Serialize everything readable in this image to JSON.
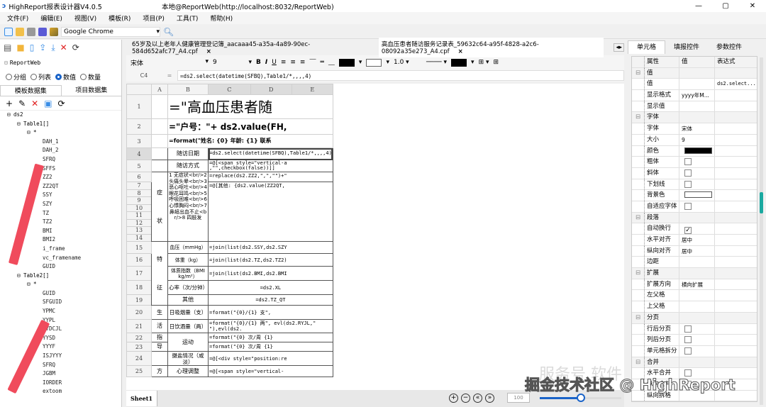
{
  "window": {
    "title": "HighReport报表设计器V4.0.5",
    "connection": "本地@ReportWeb(http://localhost:8032/ReportWeb)",
    "controls": [
      "—",
      "▢",
      "✕"
    ]
  },
  "menu": [
    "文件(F)",
    "编辑(E)",
    "视图(V)",
    "模板(R)",
    "项目(P)",
    "工具(T)",
    "帮助(H)"
  ],
  "toolbar": {
    "browser": "Google Chrome"
  },
  "left": {
    "root": "ReportWeb",
    "radios": [
      {
        "label": "分组",
        "checked": false
      },
      {
        "label": "列表",
        "checked": false
      },
      {
        "label": "数值",
        "checked": true
      },
      {
        "label": "数量",
        "checked": false
      }
    ],
    "tabs": [
      "模板数据集",
      "项目数据集"
    ],
    "tree": {
      "ds": "ds2",
      "table1": "Table1[]",
      "star": "*",
      "table1_fields": [
        "DAH_1",
        "DAH_2",
        "SFRQ",
        "SFFS",
        "ZZ2",
        "ZZ2QT",
        "SSY",
        "SZY",
        "TZ",
        "TZ2",
        "BMI",
        "BMI2",
        "i_frame",
        "vc_framename",
        "GUID"
      ],
      "table2": "Table2[]",
      "table2_fields": [
        "GUID",
        "SFGUID",
        "YPMC",
        "YYPL",
        "YYDCJL",
        "YYSD",
        "YYYF",
        "ISJYYY",
        "SFRQ",
        "JGBM",
        "IORDER",
        "extoom"
      ]
    }
  },
  "doc_tabs": [
    "65岁及以上老年人健康管理登记簿_aacaaa45-a35a-4a89-90ec-584d652afc77_A4.cpf",
    "高血压患者随访服务记录表_59632c64-a95f-4828-a2c6-08092a35e273_A4.cpf"
  ],
  "format_bar": {
    "font": "宋体",
    "size": "9",
    "line_width": "1.0",
    "bold": "B",
    "italic": "I",
    "underline": "U"
  },
  "formula": {
    "cell": "C4",
    "eq": "=",
    "value": "=ds2.select(datetime(SFBQ),Table1/*,,,,4)"
  },
  "sheet": {
    "columns": [
      "A",
      "B",
      "C",
      "D",
      "E"
    ],
    "r1": "=\"高血压患者随",
    "r2": "=\"户号：\"+ ds2.value(FH,",
    "r3": "=format(\"姓名: {0}  年龄: {1}  联系",
    "r4b": "随访日期",
    "r4c": "=ds2.select(datetime(SFBQ),Table1/*,,,,4)",
    "r5b": "随访方式",
    "r5c": "=@[<span style=\"vertical-a ,\"\",checkbox(false))]]",
    "a_sym1": "症",
    "a_sym2": "状",
    "r6b": "1 无症状<br/>2 头痛头晕<br/>3 恶心呕吐<br/>4 眼花耳鸣<br/>5 呼吸困难<br/>6 心悸胸闷<br/>7 鼻衄出血不止<br/>8 四肢发",
    "r6c": "=replace(ds2.ZZ2,\",\",\"\")+\"",
    "r7c": "=@[其他: {ds2.value(ZZ2QT,",
    "a_sign1": "特",
    "a_sign2": "征",
    "r15b": "血压（mmHg）",
    "r15c": "=join(list(ds2.SSY,ds2.SZY",
    "r16b": "体重（kg）",
    "r16c": "=join(list(ds2.TZ,ds2.TZ2)",
    "r17b": "体质指数（BMI kg/m²）",
    "r17c": "=join(list(ds2.BMI,ds2.BMI",
    "r18b": "心率（次/分钟）",
    "r18c": "=ds2.XL",
    "r19b": "其他",
    "r19c": "=ds2.TZ_QT",
    "a_life": [
      "生",
      "活",
      "指",
      "导",
      "方"
    ],
    "r20b": "日吸烟量（支）",
    "r20c": "=format(\"{0}/{1}     支\",",
    "r21b": "日饮酒量（两）",
    "r21c": "=format(\"{0}/{1}    两\", evl(ds2.RYJL,\" \"),evl(ds2.",
    "r22b": "运动",
    "r22c": "=format(\"{0} 次/周    {1}",
    "r23c": "=format(\"{0} 次/周    {1}",
    "r24b": "摄盐情况（咸淡）",
    "r24c": "=@[<div style=\"position:re",
    "r25b": "心理调整",
    "r25c": "=@[<span style=\"vertical-"
  },
  "sheet_tab": "Sheet1",
  "zoom": {
    "value": "100",
    "percent": 50
  },
  "right": {
    "tabs": [
      "单元格",
      "填报控件",
      "参数控件"
    ],
    "headers": [
      "属性",
      "值",
      "表达式"
    ],
    "rows": [
      {
        "cat": "值"
      },
      {
        "k": "值",
        "v": "",
        "e": "ds2.select..."
      },
      {
        "k": "显示格式",
        "v": "yyyy年M...",
        "e": ""
      },
      {
        "k": "显示值",
        "v": "",
        "e": ""
      },
      {
        "cat": "字体"
      },
      {
        "k": "字体",
        "v": "宋体"
      },
      {
        "k": "大小",
        "v": "9"
      },
      {
        "k": "颜色",
        "swatch": "#000000"
      },
      {
        "k": "粗体",
        "check": false
      },
      {
        "k": "斜体",
        "check": false
      },
      {
        "k": "下划线",
        "check": false
      },
      {
        "k": "背景色",
        "swatch": "#ffffff"
      },
      {
        "k": "自适应字体",
        "check": false
      },
      {
        "cat": "段落"
      },
      {
        "k": "自动换行",
        "check": true
      },
      {
        "k": "水平对齐",
        "v": "居中"
      },
      {
        "k": "纵向对齐",
        "v": "居中"
      },
      {
        "k": "边距",
        "v": ""
      },
      {
        "cat": "扩展"
      },
      {
        "k": "扩展方向",
        "v": "横向扩展"
      },
      {
        "k": "左父格",
        "v": ""
      },
      {
        "k": "上父格",
        "v": ""
      },
      {
        "cat": "分页"
      },
      {
        "k": "行后分页",
        "check": false
      },
      {
        "k": "列后分页",
        "check": false
      },
      {
        "k": "单元格拆分",
        "check": false
      },
      {
        "cat": "合并"
      },
      {
        "k": "水平合并",
        "check": false
      },
      {
        "k": "纵向合并",
        "check": false
      },
      {
        "k": "纵向拆格",
        "v": ""
      }
    ]
  },
  "watermark": {
    "main": "掘金技术社区 @ HighReport",
    "faint": "服务号  软件"
  }
}
